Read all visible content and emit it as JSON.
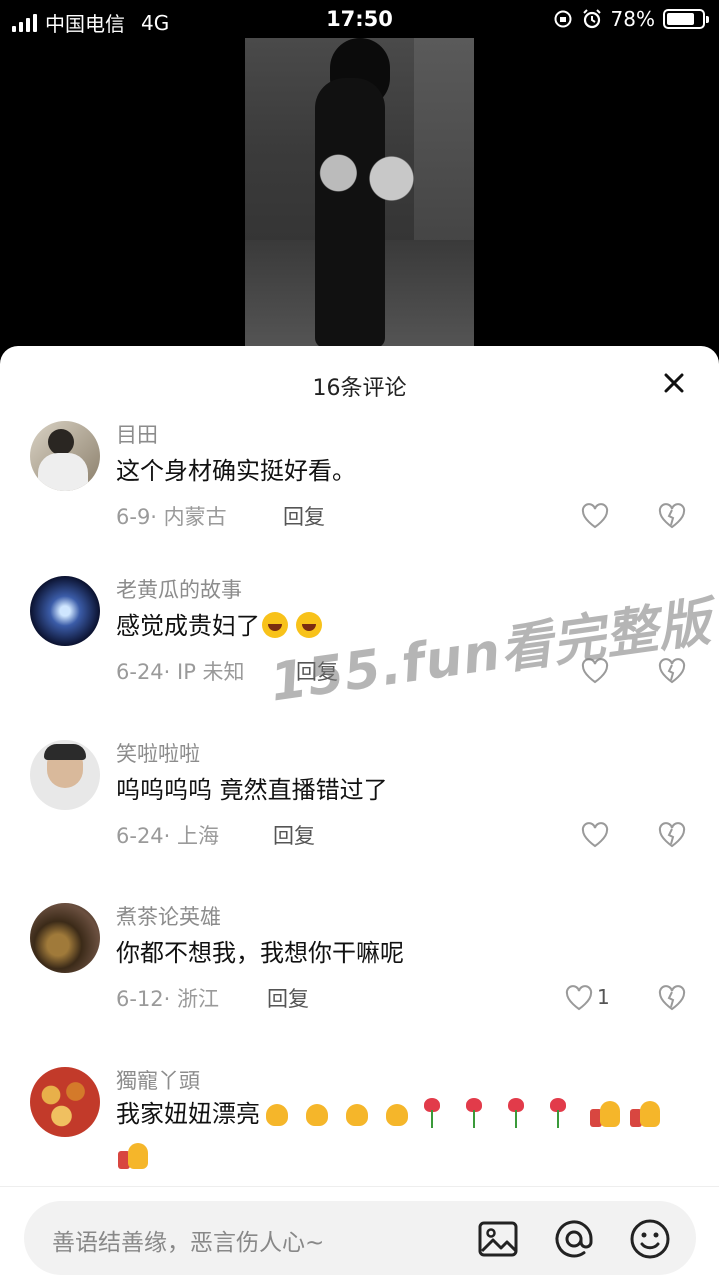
{
  "status_bar": {
    "carrier": "中国电信",
    "network": "4G",
    "time": "17:50",
    "battery_percent": "78%",
    "battery_level": 0.78
  },
  "watermark": "155.fun看完整版",
  "sheet": {
    "title": "16条评论",
    "close_icon": "close-icon"
  },
  "comments": [
    {
      "name": "目田",
      "text": "这个身材确实挺好看。",
      "meta": "6-9· 内蒙古",
      "reply": "回复",
      "like_count": ""
    },
    {
      "name": "老黄瓜的故事",
      "text": "感觉成贵妇了",
      "meta": "6-24· IP 未知",
      "reply": "回复",
      "like_count": ""
    },
    {
      "name": "笑啦啦啦",
      "text": "呜呜呜呜 竟然直播错过了",
      "meta": "6-24· 上海",
      "reply": "回复",
      "like_count": ""
    },
    {
      "name": "煮茶论英雄",
      "text": "你都不想我，我想你干嘛呢",
      "meta": "6-12· 浙江",
      "reply": "回复",
      "like_count": "1"
    },
    {
      "name": "獨寵丫頭",
      "text": "我家妞妞漂亮",
      "meta": "",
      "reply": "",
      "like_count": ""
    }
  ],
  "input": {
    "placeholder": "善语结善缘，恶言伤人心~",
    "icons": [
      "image-icon",
      "mention-icon",
      "emoji-icon"
    ]
  },
  "colors": {
    "accent": "#111111",
    "muted": "#8c8c8c",
    "background": "#ffffff"
  }
}
